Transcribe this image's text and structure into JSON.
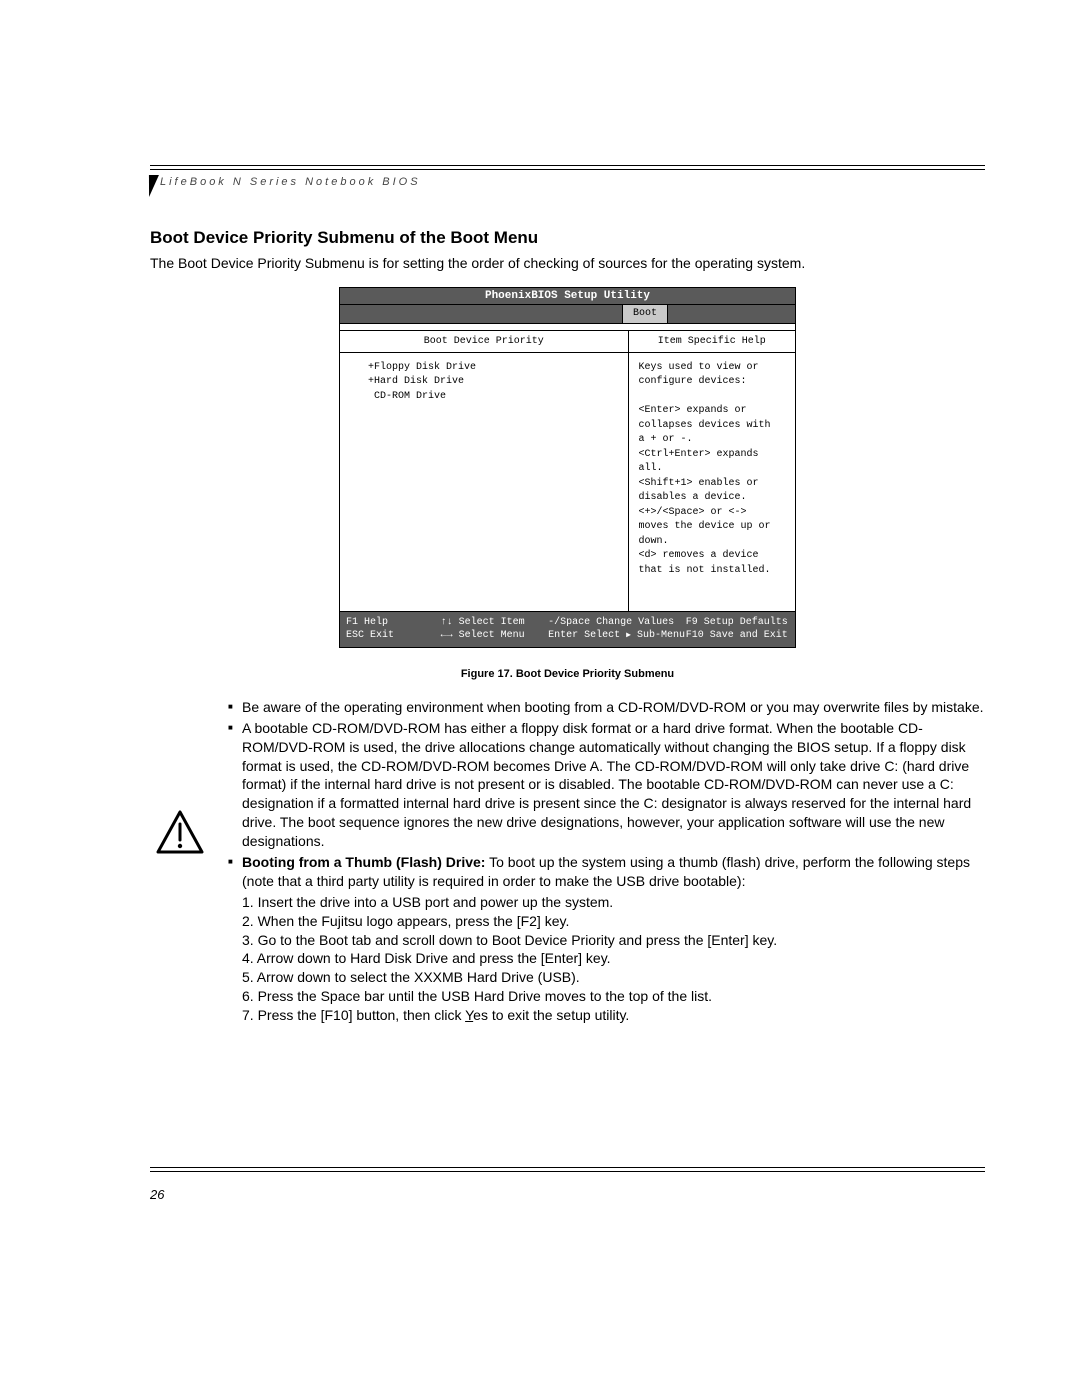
{
  "header": {
    "running_head": "LifeBook N Series Notebook BIOS"
  },
  "section": {
    "title": "Boot Device Priority Submenu of the Boot Menu",
    "intro": "The Boot Device Priority Submenu is for setting the order of checking of sources for the operating system."
  },
  "bios": {
    "title": "PhoenixBIOS Setup Utility",
    "active_tab": "Boot",
    "left_header": "Boot Device Priority",
    "right_header": "Item Specific Help",
    "devices": "+Floppy Disk Drive\n+Hard Disk Drive\n CD-ROM Drive",
    "help_text": "Keys used to view or\nconfigure devices:\n\n<Enter> expands or\ncollapses devices with\na + or -.\n<Ctrl+Enter> expands\nall.\n<Shift+1> enables or\ndisables a device.\n<+>/<Space> or <->\nmoves the device up or\ndown.\n<d> removes a device\nthat is not installed.",
    "footer": {
      "c1a": "F1  Help",
      "c1b": "ESC Exit",
      "c2a": "↑↓ Select Item",
      "c2b": "←→ Select Menu",
      "c3a": "-/Space Change Values",
      "c3b_pre": "Enter   Select ",
      "c3b_post": " Sub-Menu",
      "c4a": "F9  Setup Defaults",
      "c4b": "F10 Save and Exit"
    }
  },
  "caption": "Figure 17.  Boot Device Priority Submenu",
  "bullets": {
    "b1": "Be aware of the operating environment when booting from a CD-ROM/DVD-ROM or you may overwrite files by mistake.",
    "b2": "A bootable CD-ROM/DVD-ROM has either a floppy disk format or a hard drive format. When the bootable CD-ROM/DVD-ROM is used, the drive allocations change automatically without changing the BIOS setup. If a floppy disk format is used, the CD-ROM/DVD-ROM becomes Drive A. The CD-ROM/DVD-ROM will only take drive C: (hard drive format) if the internal hard drive is not present or is disabled. The bootable CD-ROM/DVD-ROM can never use a C: designation if a formatted internal hard drive is present since the C: designator is always reserved for the internal hard drive. The boot sequence ignores the new drive designations, however, your application software will use the new designations.",
    "b3_bold": "Booting from a Thumb (Flash) Drive:",
    "b3_rest": " To boot up the system using a thumb (flash) drive, perform the following steps (note that a third party utility is required in order to make the USB drive bootable):",
    "steps": {
      "s1": "1. Insert the drive into a USB port and power up the system.",
      "s2": "2. When the Fujitsu logo appears, press the [F2] key.",
      "s3": "3. Go to the Boot tab and scroll down to Boot Device Priority and press the [Enter] key.",
      "s4": "4. Arrow down to Hard Disk Drive and press the [Enter] key.",
      "s5": "5. Arrow down to select the XXXMB Hard Drive (USB).",
      "s6": "6. Press the Space bar until the USB Hard Drive moves to the top of the list.",
      "s7_pre": "7. Press the [F10] button, then click ",
      "s7_u": "Y",
      "s7_post": "es to exit the setup utility."
    }
  },
  "page_number": "26"
}
